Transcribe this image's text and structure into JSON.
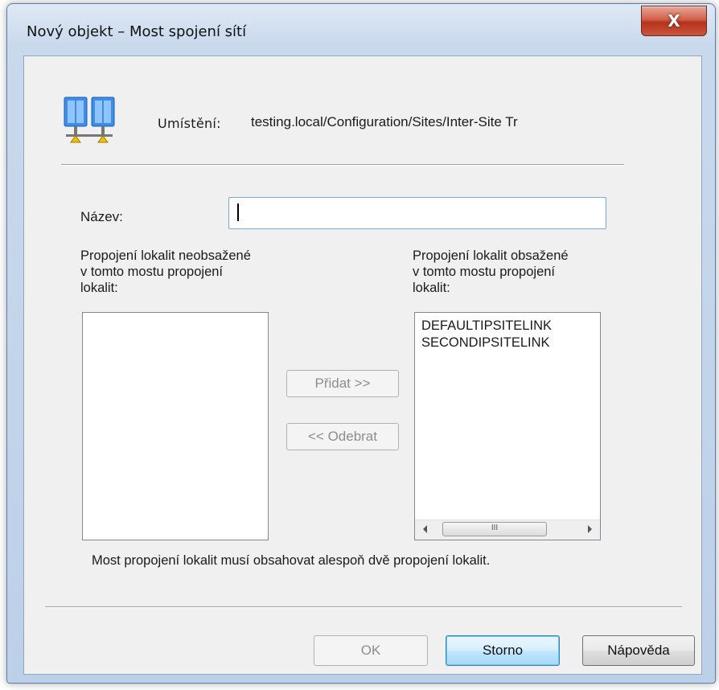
{
  "window": {
    "title": "Nový objekt – Most spojení sítí",
    "close_label": "X"
  },
  "header": {
    "icon": "network-bridge-icon",
    "location_label": "Umístění:",
    "location_value": "testing.local/Configuration/Sites/Inter-Site Tr"
  },
  "form": {
    "name_label": "Název:",
    "name_value": "",
    "left_caption": [
      "Propojení lokalit neobsažené",
      "v tomto mostu propojení",
      "lokalit:"
    ],
    "left_items": [],
    "right_caption": [
      "Propojení lokalit obsažené",
      "v tomto mostu propojení",
      "lokalit:"
    ],
    "right_items": [
      "DEFAULTIPSITELINK",
      "SECONDIPSITELINK"
    ],
    "add_button": "Přidat >>",
    "remove_button": "<< Odebrat",
    "note": "Most propojení lokalit musí obsahovat alespoň dvě propojení lokalit."
  },
  "footer": {
    "ok": "OK",
    "cancel": "Storno",
    "help": "Nápověda"
  },
  "colors": {
    "close_button": "#c9553d",
    "default_button_border": "#3c7fb1",
    "client_background": "#f0f0f0"
  }
}
